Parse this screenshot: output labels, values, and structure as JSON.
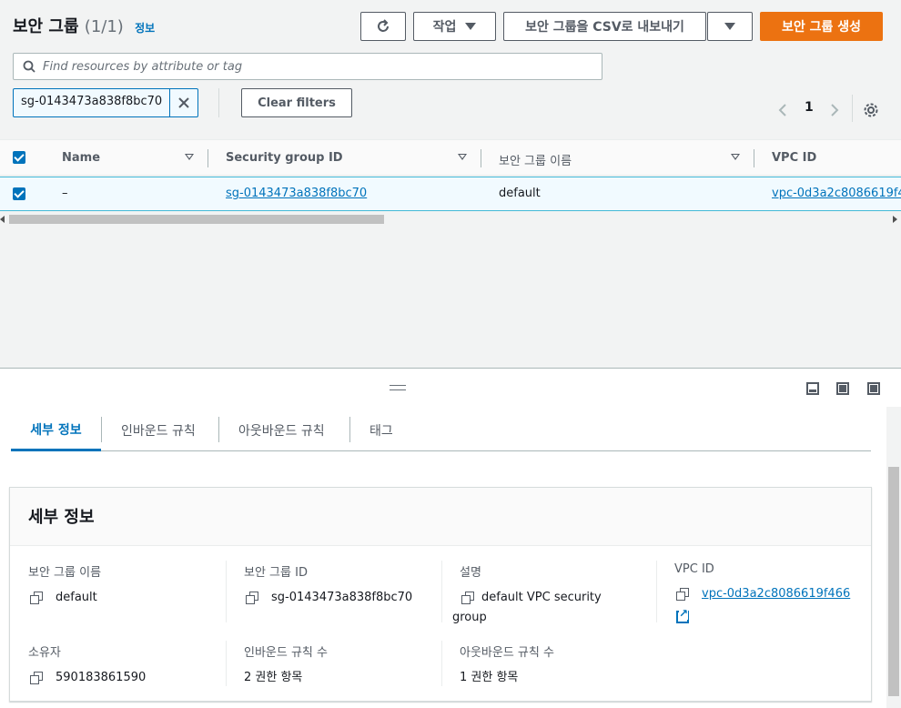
{
  "header": {
    "title": "보안 그룹",
    "count": "(1/1)",
    "info_link": "정보",
    "actions_label": "작업",
    "export_label": "보안 그룹을 CSV로 내보내기",
    "create_label": "보안 그룹 생성"
  },
  "search": {
    "placeholder": "Find resources by attribute or tag",
    "filter_token": "sg-0143473a838f8bc70",
    "clear_label": "Clear filters"
  },
  "pagination": {
    "page": "1"
  },
  "table": {
    "columns": [
      "Name",
      "Security group ID",
      "보안 그룹 이름",
      "VPC ID"
    ],
    "rows": [
      {
        "name": "–",
        "id": "sg-0143473a838f8bc70",
        "group_name": "default",
        "vpc": "vpc-0d3a2c8086619f4"
      }
    ]
  },
  "tabs": [
    "세부 정보",
    "인바운드 규칙",
    "아웃바운드 규칙",
    "태그"
  ],
  "details": {
    "title": "세부 정보",
    "fields": {
      "group_name_label": "보안 그룹 이름",
      "group_name_value": "default",
      "group_id_label": "보안 그룹 ID",
      "group_id_value": "sg-0143473a838f8bc70",
      "desc_label": "설명",
      "desc_value": "default VPC security group",
      "vpc_label": "VPC ID",
      "vpc_value": "vpc-0d3a2c8086619f466",
      "owner_label": "소유자",
      "owner_value": "590183861590",
      "inbound_label": "인바운드 규칙 수",
      "inbound_value": "2 권한 항목",
      "outbound_label": "아웃바운드 규칙 수",
      "outbound_value": "1 권한 항목"
    }
  },
  "colors": {
    "primary": "#ec7211",
    "link": "#0073bb",
    "selected_row": "#f1faff"
  }
}
